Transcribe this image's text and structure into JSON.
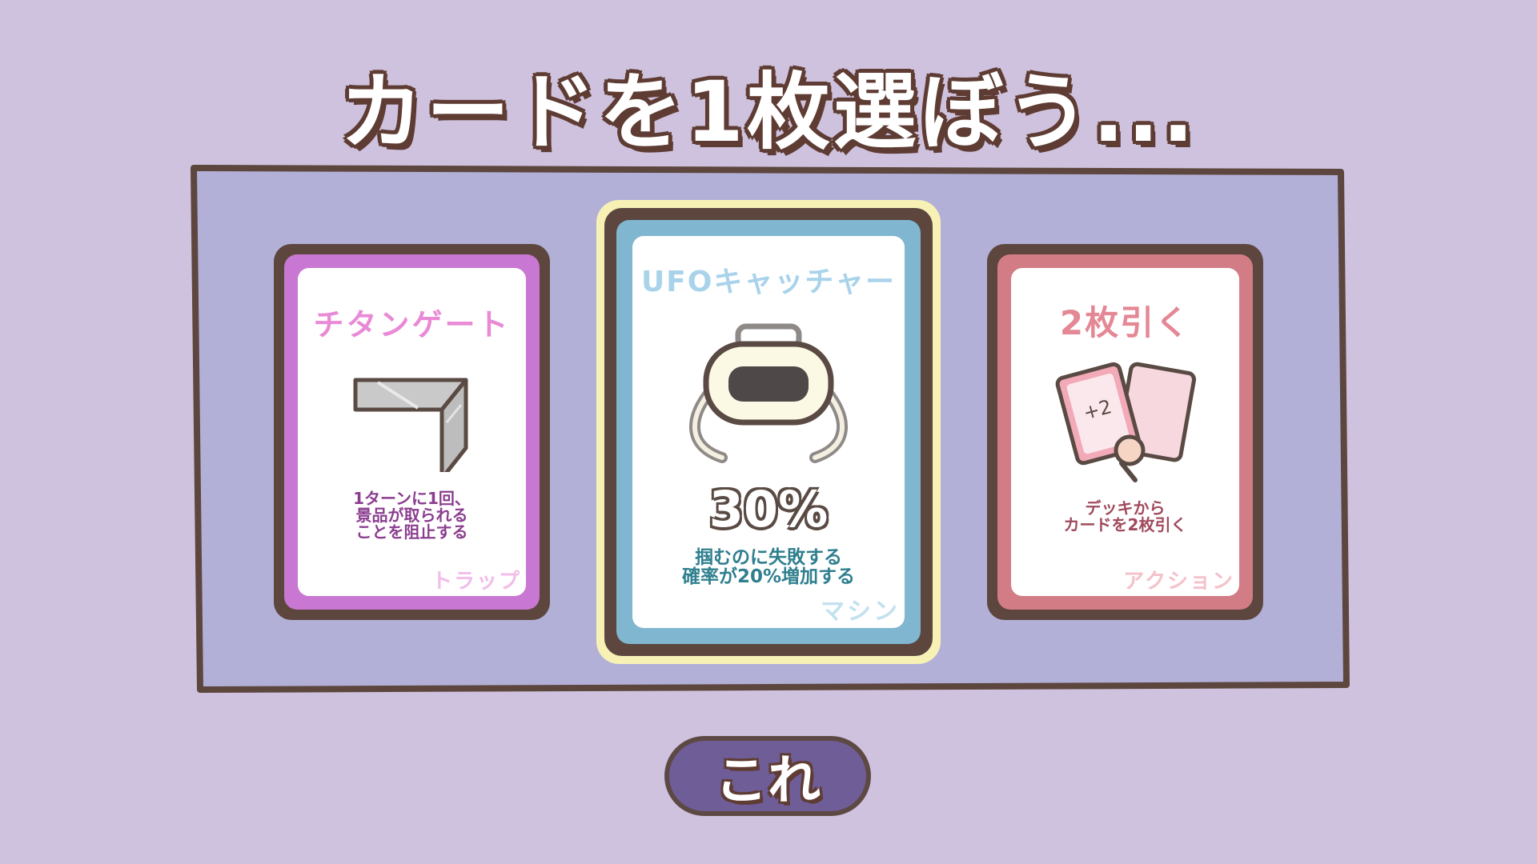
{
  "screen": {
    "title": "カードを1枚選ぼう...",
    "confirm_label": "これ"
  },
  "colors": {
    "background": "#cfc2de",
    "panel": "#b3b0d8",
    "outline": "#5c463e",
    "highlight": "#f7f1b5",
    "button": "#6f5d97"
  },
  "cards": [
    {
      "title": "チタンゲート",
      "description_lines": [
        "1ターンに1回、",
        "景品が取られる",
        "ことを阻止する"
      ],
      "type": "トラップ",
      "icon": "titanium-gate-icon",
      "accent": "#c878d2",
      "text_color": "#8b3d8f",
      "selected": false
    },
    {
      "title": "UFOキャッチャー",
      "stat": "30%",
      "description_lines": [
        "掴むのに失敗する",
        "確率が20%増加する"
      ],
      "type": "マシン",
      "icon": "ufo-claw-icon",
      "accent": "#80b6cf",
      "text_color": "#2f7f8f",
      "selected": true
    },
    {
      "title": "2枚引く",
      "description_lines": [
        "デッキから",
        "カードを2枚引く"
      ],
      "type": "アクション",
      "icon": "draw-cards-icon",
      "card_badge": "+2",
      "accent": "#d27d86",
      "text_color": "#a04a5c",
      "selected": false
    }
  ]
}
